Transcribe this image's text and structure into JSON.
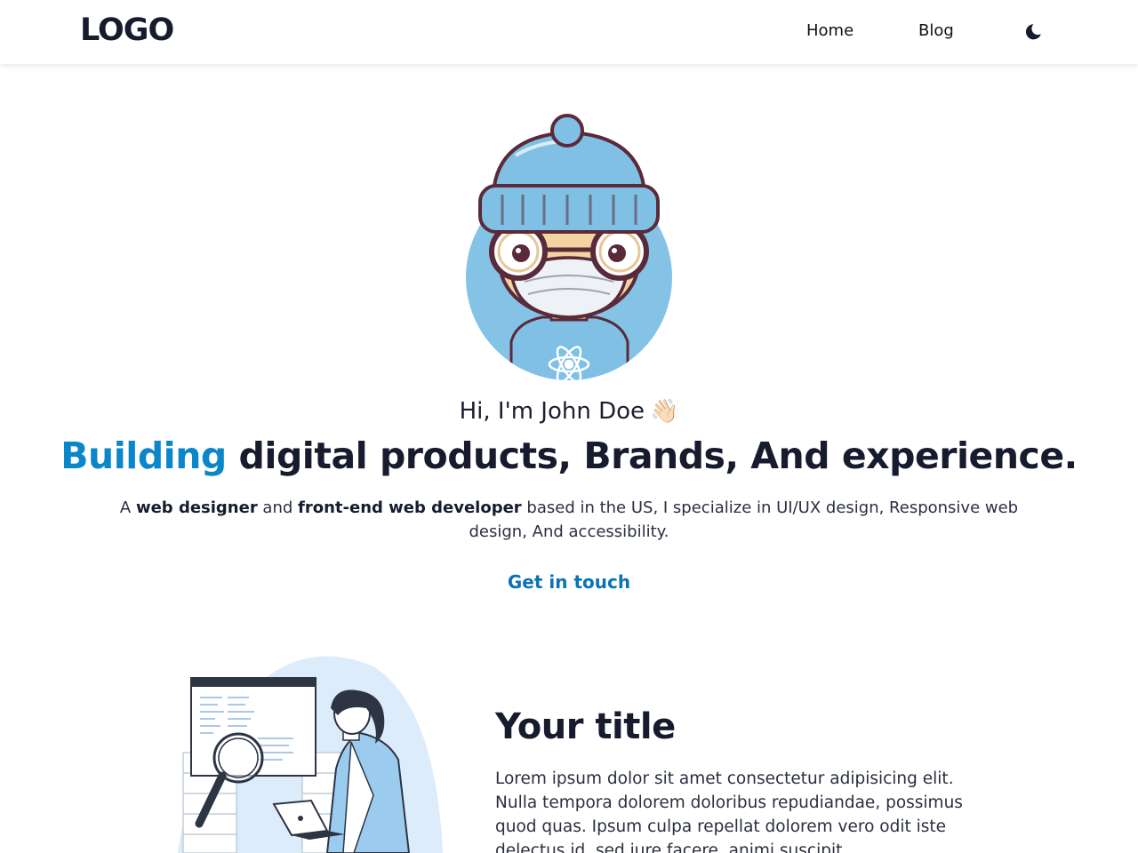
{
  "header": {
    "logo": "LOGO",
    "nav": {
      "home": "Home",
      "blog": "Blog"
    },
    "theme_icon": "moon-icon"
  },
  "hero": {
    "greeting": "Hi, I'm John Doe",
    "wave_emoji": "👋🏻",
    "headline_accent": "Building",
    "headline_rest": " digital products, Brands, And experience.",
    "intro": {
      "prefix": "A ",
      "role1": "web designer",
      "connector": " and ",
      "role2": "front-end web developer",
      "suffix": " based in the US, I specialize in UI/UX design, Responsive web design, And accessibility."
    },
    "cta": "Get in touch"
  },
  "feature": {
    "title": "Your title",
    "body": "Lorem ipsum dolor sit amet consectetur adipisicing elit. Nulla tempora dolorem doloribus repudiandae, possimus quod quas. Ipsum culpa repellat dolorem vero odit iste delectus id, sed iure facere, animi suscipit."
  },
  "colors": {
    "accent": "#0a86c9",
    "cta": "#0a73b6",
    "text": "#161b2d",
    "avatar_bg": "#84c3e6"
  }
}
